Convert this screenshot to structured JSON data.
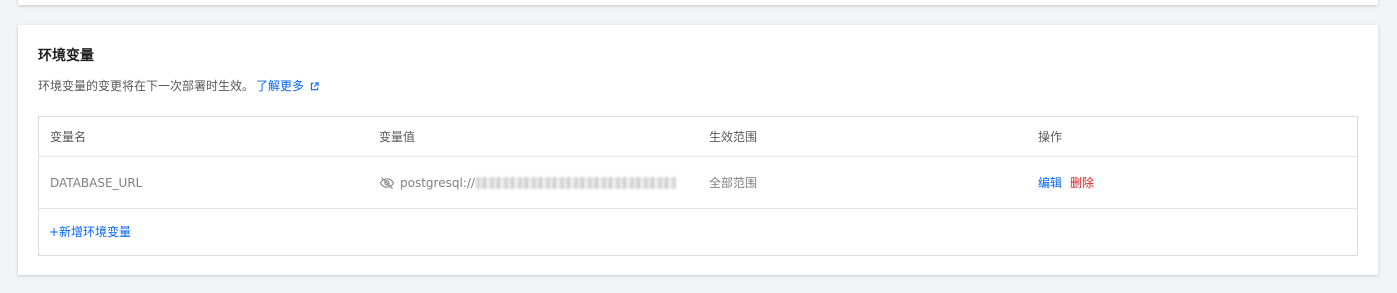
{
  "section": {
    "title": "环境变量",
    "description": "环境变量的变更将在下一次部署时生效。",
    "learn_more": "了解更多"
  },
  "table": {
    "columns": [
      "变量名",
      "变量值",
      "生效范围",
      "操作"
    ],
    "rows": [
      {
        "name": "DATABASE_URL",
        "value_prefix": "postgresql://",
        "value_hidden": true,
        "scope": "全部范围",
        "actions": [
          "编辑",
          "删除"
        ]
      }
    ],
    "add_label": "+新增环境变量"
  },
  "icons": {
    "hidden_value": "eye-off-icon",
    "external_link": "external-link-icon"
  },
  "colors": {
    "link": "#0066ff",
    "danger": "#e02020",
    "background": "#f2f3f7"
  }
}
